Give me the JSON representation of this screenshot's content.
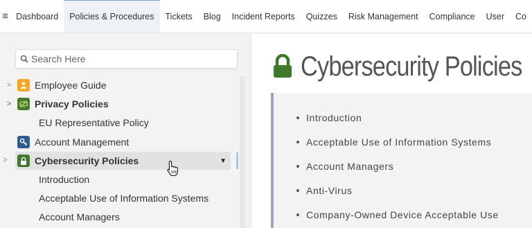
{
  "nav": {
    "menu_icon": "hamburger-icon",
    "items": [
      {
        "label": "Dashboard"
      },
      {
        "label": "Policies & Procedures"
      },
      {
        "label": "Tickets"
      },
      {
        "label": "Blog"
      },
      {
        "label": "Incident Reports"
      },
      {
        "label": "Quizzes"
      },
      {
        "label": "Risk Management"
      },
      {
        "label": "Compliance"
      },
      {
        "label": "User"
      },
      {
        "label": "Co"
      }
    ],
    "active_index": 1
  },
  "sidebar": {
    "search_placeholder": "Search Here",
    "tree": [
      {
        "label": "Employee Guide",
        "icon": "person-icon",
        "icon_color": "#f5a623"
      },
      {
        "label": "Privacy Policies",
        "icon": "eye-off-icon",
        "icon_color": "#4a7b2a"
      },
      {
        "label": "EU Representative Policy"
      },
      {
        "label": "Account Management",
        "icon": "key-icon",
        "icon_color": "#2f5b8f"
      },
      {
        "label": "Cybersecurity Policies",
        "icon": "lock-icon",
        "icon_color": "#3f7a2a"
      },
      {
        "label": "Introduction"
      },
      {
        "label": "Acceptable Use of Information Systems"
      },
      {
        "label": "Account Managers"
      }
    ]
  },
  "main": {
    "title": "Cybersecurity Policies",
    "title_icon": "lock-icon",
    "toc": [
      {
        "label": "Introduction"
      },
      {
        "label": "Acceptable Use of Information Systems"
      },
      {
        "label": "Account Managers"
      },
      {
        "label": "Anti-Virus"
      },
      {
        "label": "Company-Owned Device Acceptable Use"
      }
    ]
  },
  "colors": {
    "accent": "#7aa0d4",
    "toc_border": "#a59ec4",
    "lock_green": "#3f7a2a"
  }
}
